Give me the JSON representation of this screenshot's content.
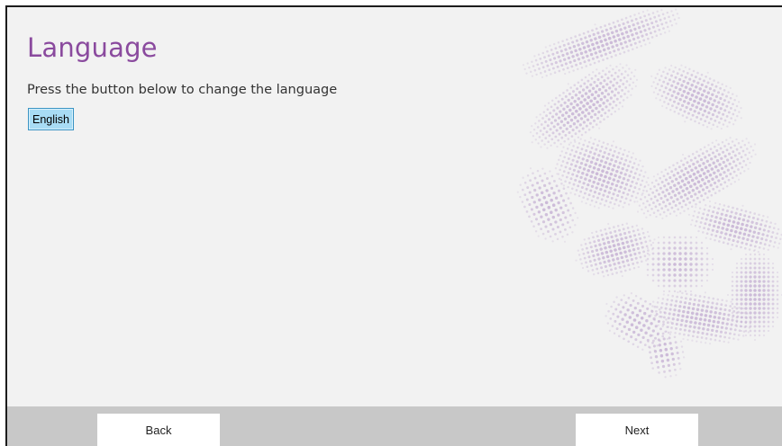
{
  "page": {
    "title": "Language",
    "instruction": "Press the button below to change the language"
  },
  "language_button": {
    "label": "English"
  },
  "footer": {
    "back_label": "Back",
    "next_label": "Next"
  },
  "colors": {
    "title": "#8a4a9e",
    "background": "#f2f2f2",
    "footer": "#c8c8c8",
    "language_button_fill": "#a8dcf4",
    "language_button_border": "#3a94c4",
    "decoration": "#b69ac9"
  }
}
